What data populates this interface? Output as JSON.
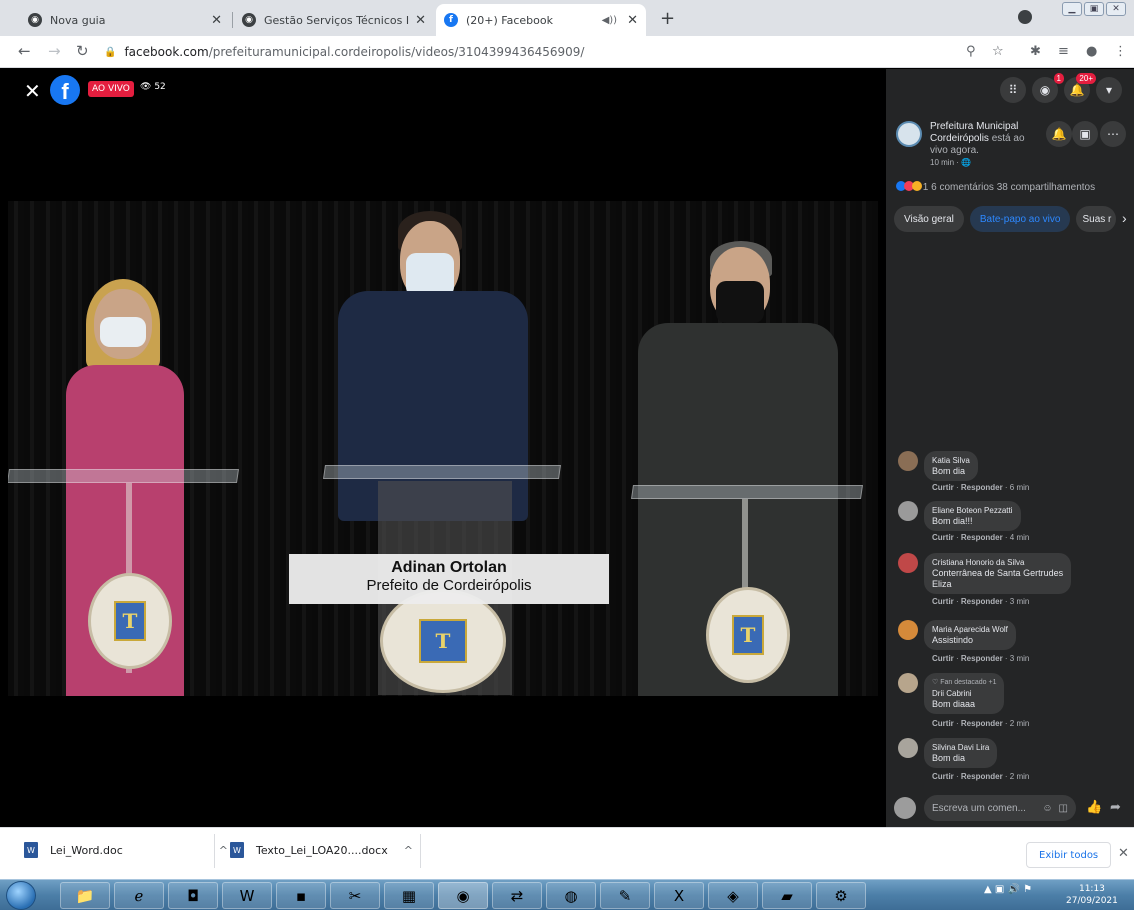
{
  "browser": {
    "tabs": [
      {
        "label": "Nova guia",
        "active": false
      },
      {
        "label": "Gestão Serviços Técnicos IBNS",
        "active": false
      },
      {
        "label": "(20+) Facebook",
        "active": true
      }
    ],
    "url_host": "facebook.com",
    "url_path": "/prefeituramunicipal.cordeiropolis/videos/3104399436456909/"
  },
  "video": {
    "live_label": "AO VIVO",
    "viewer_count": "52",
    "lower_third_name": "Adinan Ortolan",
    "lower_third_role": "Prefeito de Cordeirópolis"
  },
  "header_icons": {
    "messenger_badge": "1",
    "notifications_badge": "20+"
  },
  "post": {
    "page_name": "Prefeitura Municipal Cordeirópolis",
    "status": " está ao vivo agora.",
    "time": "10 min · ",
    "reaction_count": "1",
    "comments_text": "6 comentários",
    "shares_text": "38 compartilhamentos"
  },
  "panel_tabs": [
    "Visão geral",
    "Bate-papo ao vivo",
    "Suas r"
  ],
  "comments": [
    {
      "author": "Katia Silva",
      "fan_badge": "",
      "text": [
        "Bom dia"
      ],
      "like": "Curtir",
      "reply": "Responder",
      "time": "6 min"
    },
    {
      "author": "Eliane Boteon Pezzatti",
      "fan_badge": "",
      "text": [
        "Bom dia!!!"
      ],
      "like": "Curtir",
      "reply": "Responder",
      "time": "4 min"
    },
    {
      "author": "Cristiana Honorio da Silva",
      "fan_badge": "",
      "text": [
        "Conterrânea de Santa Gertrudes",
        "Eliza"
      ],
      "like": "Curtir",
      "reply": "Responder",
      "time": "3 min"
    },
    {
      "author": "Maria Aparecida Wolf",
      "fan_badge": "",
      "text": [
        "Assistindo"
      ],
      "like": "Curtir",
      "reply": "Responder",
      "time": "3 min"
    },
    {
      "author": "Drii Cabrini",
      "fan_badge": "Fan destacado +1",
      "text": [
        "Bom diaaa"
      ],
      "like": "Curtir",
      "reply": "Responder",
      "time": "2 min"
    },
    {
      "author": "Silvina Davi Lira",
      "fan_badge": "",
      "text": [
        "Bom dia"
      ],
      "like": "Curtir",
      "reply": "Responder",
      "time": "2 min"
    }
  ],
  "composer": {
    "placeholder": "Escreva um comen..."
  },
  "downloads": {
    "items": [
      "Lei_Word.doc",
      "Texto_Lei_LOA20....docx"
    ],
    "show_all": "Exibir todos"
  },
  "taskbar": {
    "time": "11:13",
    "date": "27/09/2021"
  },
  "colors": {
    "facebook_blue": "#1877f2",
    "live_red": "#e41e3f",
    "panel_bg": "#242526",
    "bubble_bg": "#3a3b3c"
  }
}
